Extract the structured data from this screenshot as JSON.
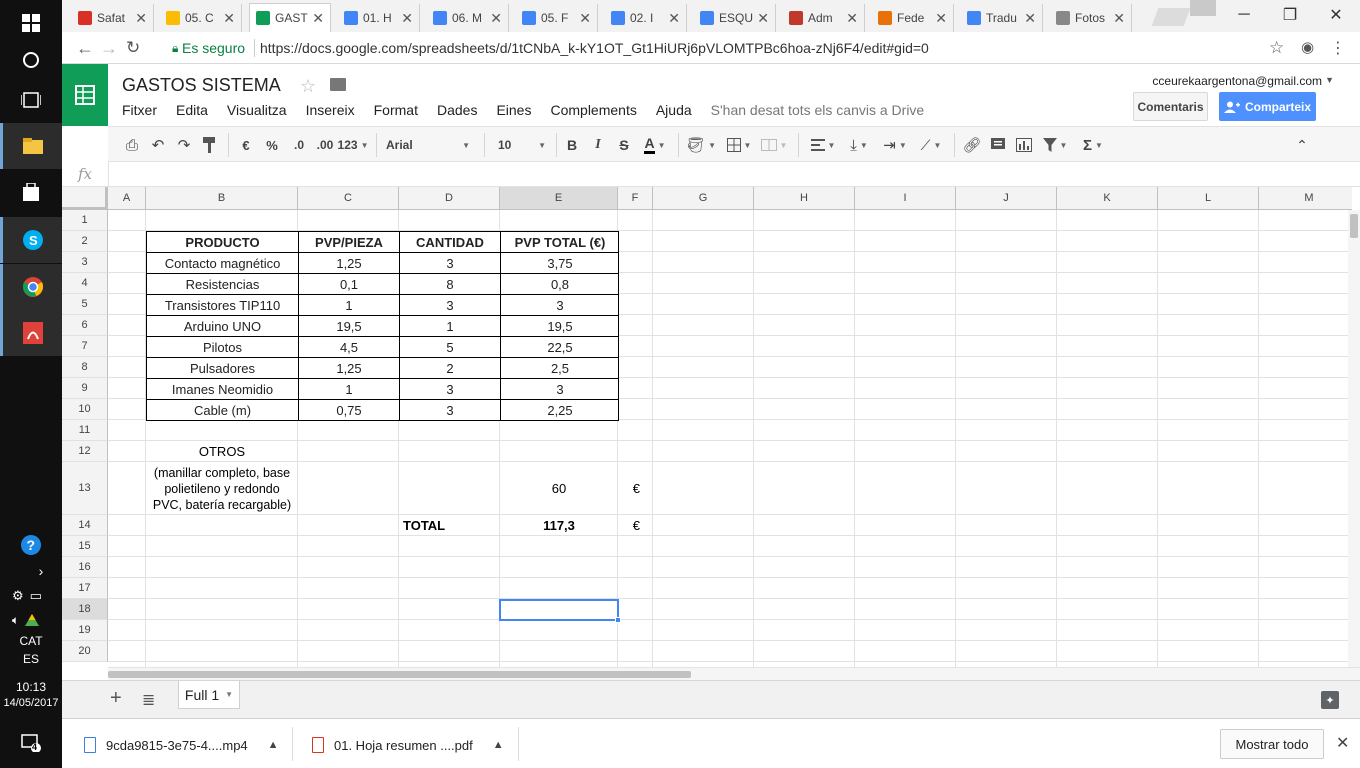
{
  "taskbar": {
    "time": "10:13",
    "date": "14/05/2017",
    "lang1": "CAT",
    "lang2": "ES",
    "notif_count": "4"
  },
  "tabs": [
    {
      "label": "Safat",
      "color": "#d93025"
    },
    {
      "label": "05. C",
      "color": "#fbbc04"
    },
    {
      "label": "GAST",
      "color": "#0f9d58",
      "active": true
    },
    {
      "label": "01. H",
      "color": "#4285f4"
    },
    {
      "label": "06. M",
      "color": "#4285f4"
    },
    {
      "label": "05. F",
      "color": "#4285f4"
    },
    {
      "label": "02. I",
      "color": "#4285f4"
    },
    {
      "label": "ESQU",
      "color": "#4285f4"
    },
    {
      "label": "Adm",
      "color": "#c0392b"
    },
    {
      "label": "Fede",
      "color": "#e8710a"
    },
    {
      "label": "Tradu",
      "color": "#4285f4"
    },
    {
      "label": "Fotos",
      "color": "#888888"
    }
  ],
  "omnibox": {
    "secure_label": "Es seguro",
    "url": "https://docs.google.com/spreadsheets/d/1tCNbA_k-kY1OT_Gt1HiURj6pVLOMTPBc6hoa-zNj6F4/edit#gid=0"
  },
  "doc": {
    "title": "GASTOS SISTEMA",
    "account": "cceurekaargentona@gmail.com",
    "comments_label": "Comentaris",
    "share_label": "Comparteix",
    "saved_status": "S'han desat tots els canvis a Drive"
  },
  "menu": [
    "Fitxer",
    "Edita",
    "Visualitza",
    "Insereix",
    "Format",
    "Dades",
    "Eines",
    "Complements",
    "Ajuda"
  ],
  "toolbar": {
    "currency": "€",
    "percent": "%",
    "dec_less": ".0",
    "dec_more": ".00",
    "more_formats": "123",
    "font": "Arial",
    "font_size": "10",
    "bold": "B",
    "italic": "I",
    "strike": "S",
    "text_color": "A",
    "sum": "Σ"
  },
  "formula_bar": {
    "fx_label": "fx",
    "content": ""
  },
  "columns": [
    "A",
    "B",
    "C",
    "D",
    "E",
    "F",
    "G",
    "H",
    "I",
    "J",
    "K",
    "L",
    "M"
  ],
  "rows": [
    "1",
    "2",
    "3",
    "4",
    "5",
    "6",
    "7",
    "8",
    "9",
    "10",
    "11",
    "12",
    "13",
    "14",
    "15",
    "16",
    "17",
    "18",
    "19",
    "20"
  ],
  "table": {
    "headers": [
      "PRODUCTO",
      "PVP/PIEZA",
      "CANTIDAD",
      "PVP TOTAL (€)"
    ],
    "rows": [
      [
        "Contacto magnético",
        "1,25",
        "3",
        "3,75"
      ],
      [
        "Resistencias",
        "0,1",
        "8",
        "0,8"
      ],
      [
        "Transistores TIP110",
        "1",
        "3",
        "3"
      ],
      [
        "Arduino UNO",
        "19,5",
        "1",
        "19,5"
      ],
      [
        "Pilotos",
        "4,5",
        "5",
        "22,5"
      ],
      [
        "Pulsadores",
        "1,25",
        "2",
        "2,5"
      ],
      [
        "Imanes Neomidio",
        "1",
        "3",
        "3"
      ],
      [
        "Cable (m)",
        "0,75",
        "3",
        "2,25"
      ]
    ]
  },
  "otros": {
    "title": "OTROS",
    "desc_line1": "(manillar completo, base",
    "desc_line2": "polietileno y redondo",
    "desc_line3": "PVC, batería recargable)",
    "value": "60",
    "currency": "€"
  },
  "total": {
    "label": "TOTAL",
    "value": "117,3",
    "currency": "€"
  },
  "sheet_tab": {
    "name": "Full 1"
  },
  "downloads": {
    "item1": "9cda9815-3e75-4....mp4",
    "item2": "01. Hoja resumen ....pdf",
    "show_all": "Mostrar todo"
  }
}
